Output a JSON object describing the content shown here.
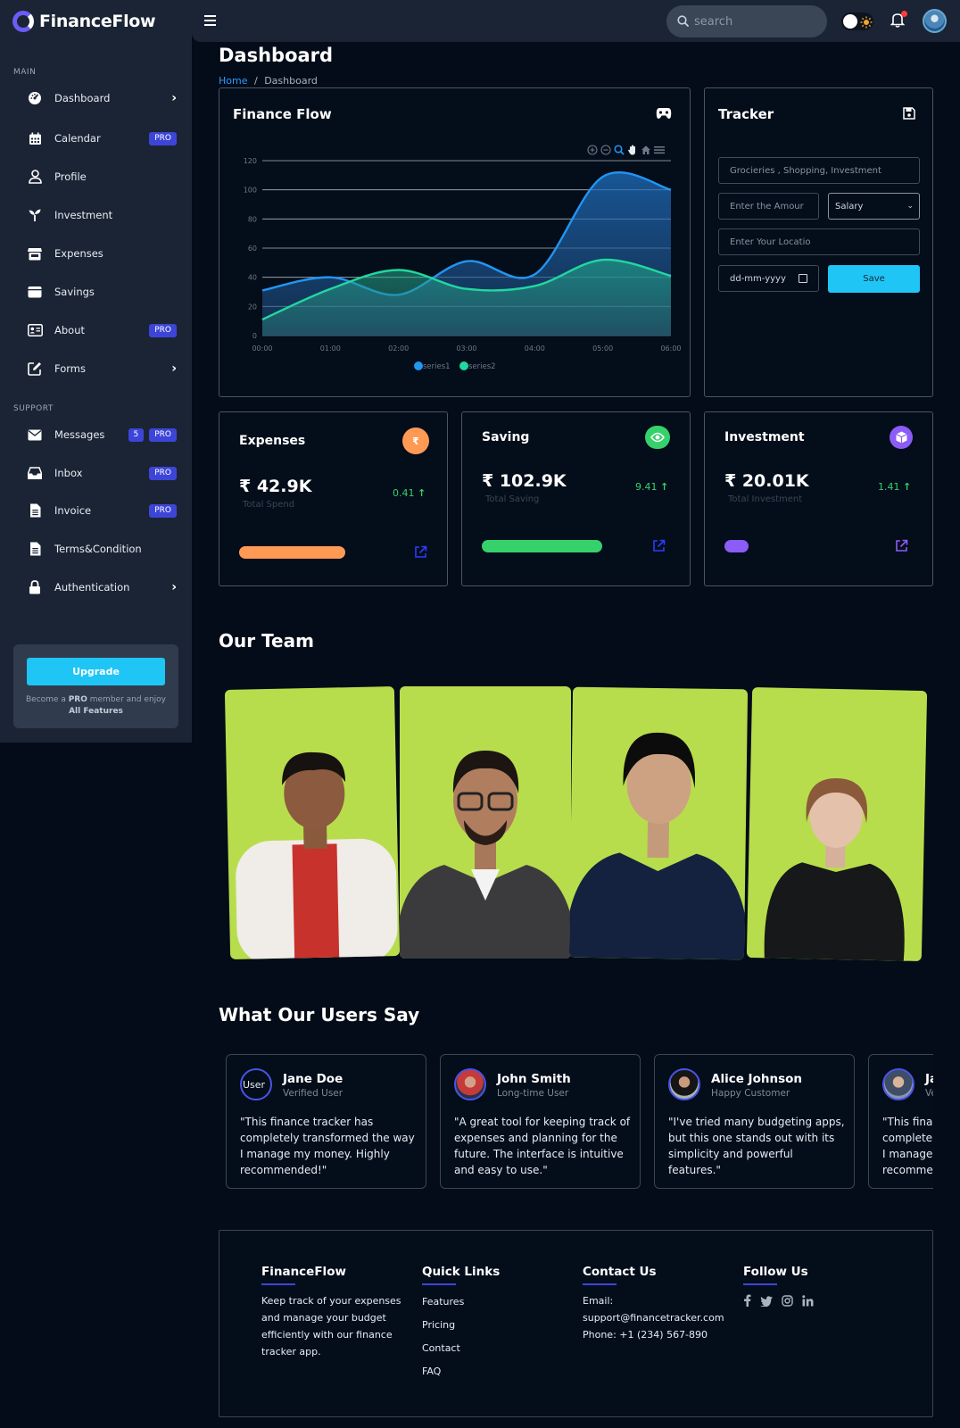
{
  "brand": {
    "name": "FinanceFlow"
  },
  "sidebar": {
    "section_main": "MAIN",
    "section_support": "SUPPORT",
    "items": [
      {
        "label": "Dashboard",
        "icon": "speedometer-icon"
      },
      {
        "label": "Calendar",
        "icon": "calendar-icon",
        "badge": "PRO"
      },
      {
        "label": "Profile",
        "icon": "user-icon"
      },
      {
        "label": "Investment",
        "icon": "sprout-icon"
      },
      {
        "label": "Expenses",
        "icon": "store-icon"
      },
      {
        "label": "Savings",
        "icon": "wallet-icon"
      },
      {
        "label": "About",
        "icon": "id-card-icon",
        "badge": "PRO"
      },
      {
        "label": "Forms",
        "icon": "edit-icon"
      }
    ],
    "support_items": [
      {
        "label": "Messages",
        "icon": "envelope-icon",
        "count": "5",
        "badge": "PRO"
      },
      {
        "label": "Inbox",
        "icon": "inbox-icon",
        "badge": "PRO"
      },
      {
        "label": "Invoice",
        "icon": "file-icon",
        "badge": "PRO"
      },
      {
        "label": "Terms&Condition",
        "icon": "document-icon"
      },
      {
        "label": "Authentication",
        "icon": "lock-icon"
      }
    ],
    "upgrade": {
      "button": "Upgrade",
      "text_prefix": "Become a ",
      "text_bold": "PRO",
      "text_mid": " member and enjoy",
      "text_bold2": "All Features"
    }
  },
  "topbar": {
    "search_placeholder": "search"
  },
  "page": {
    "title": "Dashboard",
    "breadcrumb_home": "Home",
    "breadcrumb_sep": "/",
    "breadcrumb_current": "Dashboard"
  },
  "finance_card": {
    "title": "Finance Flow"
  },
  "chart_data": {
    "type": "area",
    "x": [
      "00:00",
      "01:00",
      "02:00",
      "03:00",
      "04:00",
      "05:00",
      "06:00"
    ],
    "ylim": [
      0,
      120
    ],
    "yticks": [
      0,
      20,
      40,
      60,
      80,
      100,
      120
    ],
    "series": [
      {
        "name": "series1",
        "color": "#2196f3",
        "values": [
          31,
          40,
          28,
          51,
          42,
          109,
          100
        ]
      },
      {
        "name": "series2",
        "color": "#21d8a0",
        "values": [
          11,
          32,
          45,
          32,
          34,
          52,
          41
        ]
      }
    ],
    "legend": "bottom-center"
  },
  "tracker": {
    "title": "Tracker",
    "category_placeholder": "Grocieries , Shopping, Investment",
    "amount_placeholder": "Enter the Amour",
    "type_value": "Salary",
    "location_placeholder": "Enter Your Locatio",
    "date_value": "dd-mm-yyyy",
    "save": "Save"
  },
  "stats": [
    {
      "title": "Expenses",
      "value": "₹ 42.9K",
      "sub": "Total Spend",
      "delta": "0.41",
      "color": "#ff9a55",
      "progress": 0.53
    },
    {
      "title": "Saving",
      "value": "₹ 102.9K",
      "sub": "Total Saving",
      "delta": "9.41",
      "color": "#36d16a",
      "progress": 0.6
    },
    {
      "title": "Investment",
      "value": "₹ 20.01K",
      "sub": "Total Investment",
      "delta": "1.41",
      "color": "#8b5cf6",
      "progress": 0.12
    }
  ],
  "team": {
    "title": "Our Team"
  },
  "testimonials": {
    "title": "What Our Users Say",
    "items": [
      {
        "name": "Jane Doe",
        "role": "Verified User",
        "avatar_alt": "User",
        "quote": "\"This finance tracker has completely transformed the way I manage my money. Highly recommended!\""
      },
      {
        "name": "John Smith",
        "role": "Long-time User",
        "quote": "\"A great tool for keeping track of expenses and planning for the future. The interface is intuitive and easy to use.\""
      },
      {
        "name": "Alice Johnson",
        "role": "Happy Customer",
        "quote": "\"I've tried many budgeting apps, but this one stands out with its simplicity and powerful features.\""
      },
      {
        "name": "Jane Doe",
        "role": "Verified User",
        "quote": "\"This finance tracker has completely transformed the way I manage my money. Highly recommended!\""
      }
    ]
  },
  "footer": {
    "brand": "FinanceFlow",
    "about": "Keep track of your expenses and manage your budget efficiently with our finance tracker app.",
    "quick_links_title": "Quick Links",
    "quick_links": [
      "Features",
      "Pricing",
      "Contact",
      "FAQ"
    ],
    "contact_title": "Contact Us",
    "email_label": "Email:",
    "email": "support@financetracker.com",
    "phone": "Phone: +1 (234) 567-890",
    "follow_title": "Follow Us"
  }
}
